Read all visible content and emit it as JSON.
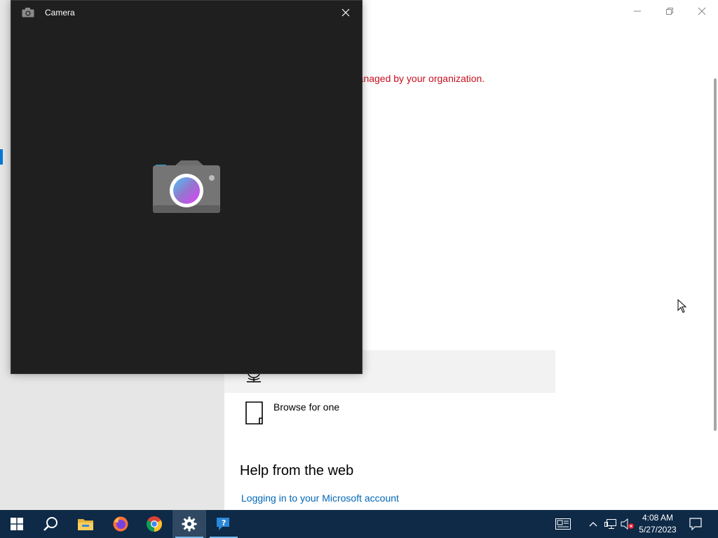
{
  "settings": {
    "policy_notice": "Some settings are hidden or managed by your organization.",
    "options": {
      "browse_label": "Browse for one"
    },
    "help": {
      "heading": "Help from the web",
      "link": "Logging in to your Microsoft account"
    }
  },
  "camera_window": {
    "title": "Camera"
  },
  "taskbar": {
    "items": [
      "start-icon",
      "search-icon",
      "file-explorer-icon",
      "firefox-icon",
      "chrome-icon",
      "settings-icon",
      "get-help-icon"
    ],
    "clock": {
      "time": "4:08 AM",
      "date": "5/27/2023"
    }
  },
  "colors": {
    "taskbar": "#0e2a47",
    "policy_red": "#c50f1f",
    "link_blue": "#0067b8",
    "camera_bg": "#1f1f1f"
  }
}
